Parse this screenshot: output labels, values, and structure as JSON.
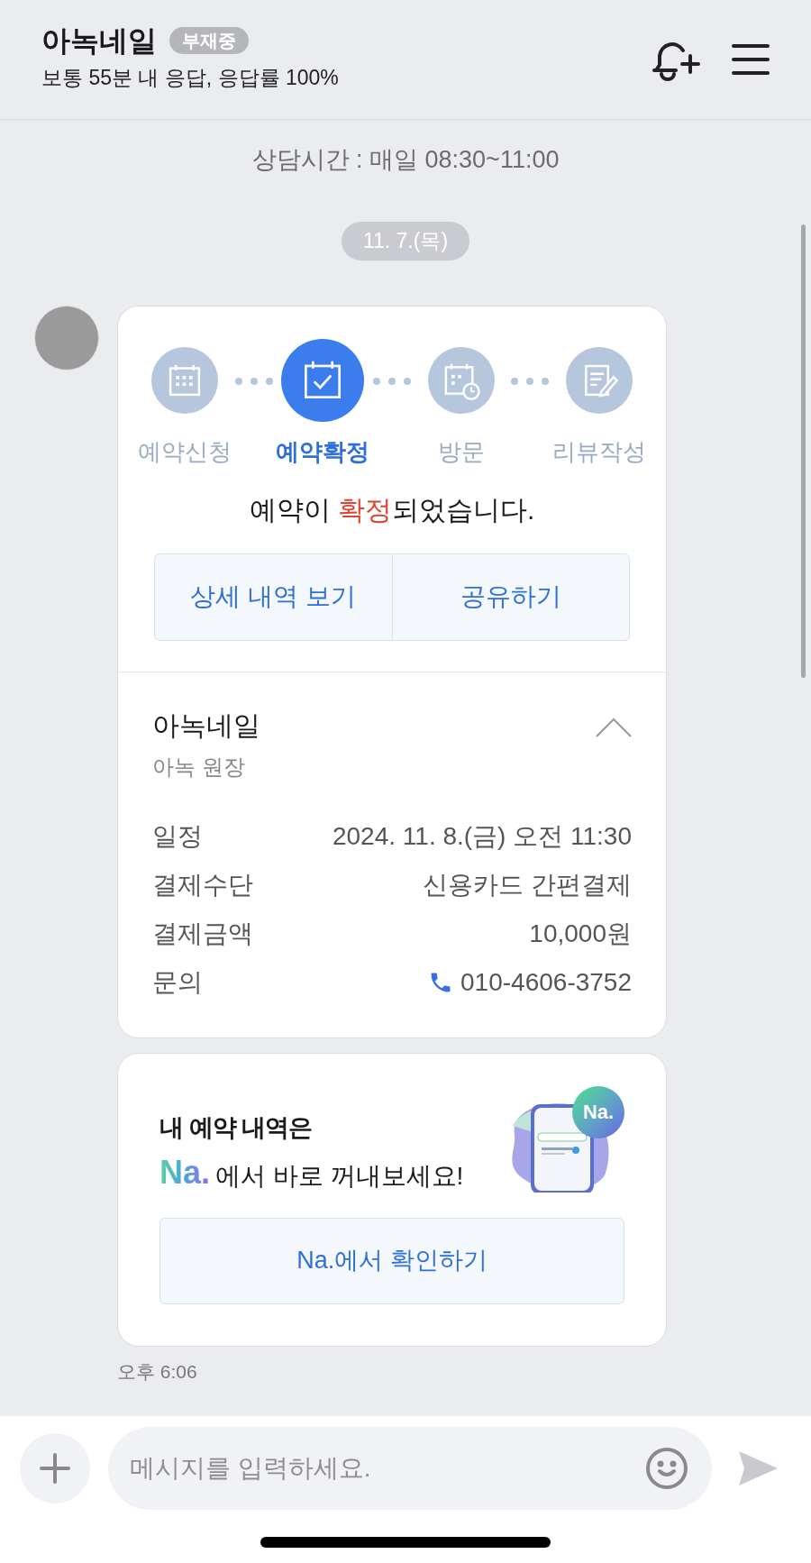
{
  "header": {
    "title": "아녹네일",
    "badge": "부재중",
    "subtitle": "보통 55분 내 응답, 응답률 100%"
  },
  "notice": "상담시간 : 매일 08:30~11:00",
  "date_divider": "11. 7.(목)",
  "reservation_card": {
    "steps": [
      {
        "label": "예약신청",
        "selected": false,
        "kind": "calendar"
      },
      {
        "label": "예약확정",
        "selected": true,
        "kind": "check"
      },
      {
        "label": "방문",
        "selected": false,
        "kind": "clock"
      },
      {
        "label": "리뷰작성",
        "selected": false,
        "kind": "review"
      }
    ],
    "message": {
      "before": "예약이 ",
      "highlight": "확정",
      "after": "되었습니다."
    },
    "buttons": [
      "상세 내역 보기",
      "공유하기"
    ],
    "shop": {
      "name": "아녹네일",
      "staff": "아녹 원장",
      "expanded": true
    },
    "details": [
      {
        "label": "일정",
        "value": "2024. 11. 8.(금) 오전 11:30",
        "kind": "text"
      },
      {
        "label": "결제수단",
        "value": "신용카드 간편결제",
        "kind": "text"
      },
      {
        "label": "결제금액",
        "value": "10,000원",
        "kind": "text"
      },
      {
        "label": "문의",
        "value": "010-4606-3752",
        "kind": "phone"
      }
    ]
  },
  "promo_card": {
    "title": "내 예약 내역은",
    "logo": "Na.",
    "text": "에서 바로 꺼내보세요!",
    "illustration_badge": "Na.",
    "button": "Na.에서 확인하기"
  },
  "timestamp": "오후 6:06",
  "composer": {
    "placeholder": "메시지를 입력하세요."
  }
}
